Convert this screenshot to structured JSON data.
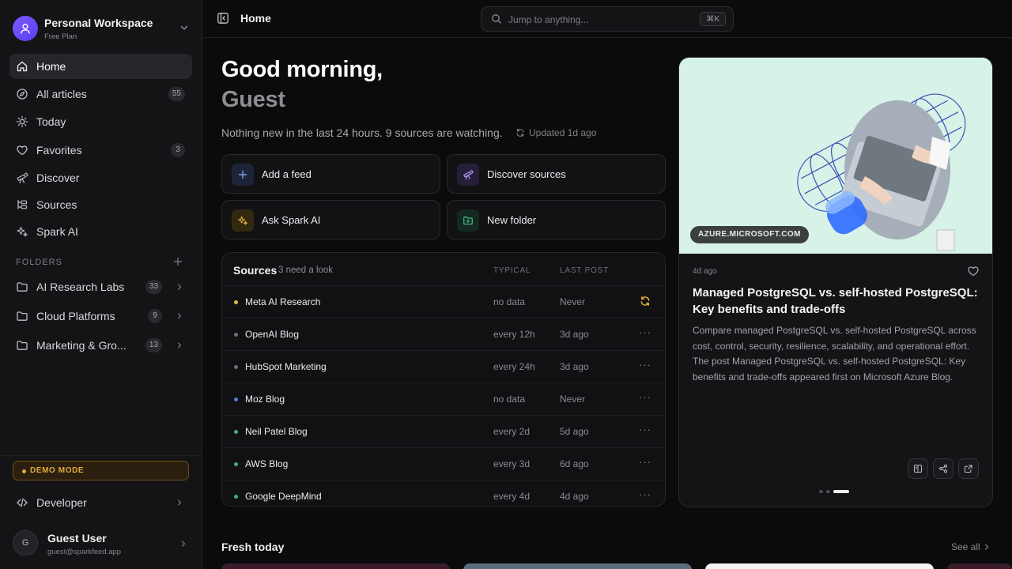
{
  "workspace": {
    "name": "Personal Workspace",
    "plan": "Free Plan"
  },
  "nav": [
    {
      "label": "Home",
      "icon": "home-icon"
    },
    {
      "label": "All articles",
      "icon": "compass-icon",
      "count": "55"
    },
    {
      "label": "Today",
      "icon": "sun-icon"
    },
    {
      "label": "Favorites",
      "icon": "heart-icon",
      "count": "3"
    },
    {
      "label": "Discover",
      "icon": "telescope-icon"
    },
    {
      "label": "Sources",
      "icon": "sources-icon"
    },
    {
      "label": "Spark AI",
      "icon": "sparkles-icon"
    }
  ],
  "folders": {
    "heading": "FOLDERS",
    "items": [
      {
        "label": "AI Research Labs",
        "count": "33"
      },
      {
        "label": "Cloud Platforms",
        "count": "9"
      },
      {
        "label": "Marketing & Gro...",
        "count": "13"
      }
    ]
  },
  "demo": {
    "label": "DEMO MODE"
  },
  "developer": {
    "label": "Developer"
  },
  "user": {
    "initial": "G",
    "name": "Guest User",
    "email": "guest@sparkfeed.app"
  },
  "topbar": {
    "title": "Home",
    "search_placeholder": "Jump to anything...",
    "shortcut": "⌘K"
  },
  "greeting": {
    "line1": "Good morning,",
    "line2": "Guest",
    "status": "Nothing new in the last 24 hours. 9 sources are watching.",
    "updated": "Updated 1d ago"
  },
  "quick_actions": [
    {
      "label": "Add a feed",
      "icon": "plus-icon"
    },
    {
      "label": "Discover sources",
      "icon": "telescope-icon"
    },
    {
      "label": "Ask Spark AI",
      "icon": "sparkles-icon"
    },
    {
      "label": "New folder",
      "icon": "folder-plus-icon"
    }
  ],
  "sources_panel": {
    "title": "Sources",
    "subtitle": "3 need a look",
    "col_typical": "TYPICAL",
    "col_last": "LAST POST",
    "rows": [
      {
        "name": "Meta AI Research",
        "typical": "no data",
        "last": "Never",
        "dot": "#e6b83c",
        "action": "refresh-icon"
      },
      {
        "name": "OpenAI Blog",
        "typical": "every 12h",
        "last": "3d ago",
        "dot": "#6f6f76",
        "action": "more-icon"
      },
      {
        "name": "HubSpot Marketing",
        "typical": "every 24h",
        "last": "3d ago",
        "dot": "#6f6f76",
        "action": "more-icon"
      },
      {
        "name": "Moz Blog",
        "typical": "no data",
        "last": "Never",
        "dot": "#4f7fd6",
        "action": "more-icon"
      },
      {
        "name": "Neil Patel Blog",
        "typical": "every 2d",
        "last": "5d ago",
        "dot": "#3fb27f",
        "action": "more-icon"
      },
      {
        "name": "AWS Blog",
        "typical": "every 3d",
        "last": "6d ago",
        "dot": "#3fb27f",
        "action": "more-icon"
      },
      {
        "name": "Google DeepMind",
        "typical": "every 4d",
        "last": "4d ago",
        "dot": "#3fb27f",
        "action": "more-icon"
      }
    ]
  },
  "feature": {
    "source": "AZURE.MICROSOFT.COM",
    "date": "4d ago",
    "title": "Managed PostgreSQL vs. self-hosted PostgreSQL: Key benefits and trade-offs",
    "body": "Compare managed PostgreSQL vs. self-hosted PostgreSQL across cost, control, security, resilience, scalability, and operational effort. The post Managed PostgreSQL vs. self-hosted PostgreSQL: Key benefits and trade-offs appeared first on Microsoft Azure Blog.",
    "carousel_active": 3,
    "carousel_total": 3
  },
  "fresh": {
    "title": "Fresh today",
    "see_all": "See all"
  },
  "colors": {
    "accent": "#7b5cff",
    "warning": "#e2a93a",
    "success": "#3fb27f"
  }
}
